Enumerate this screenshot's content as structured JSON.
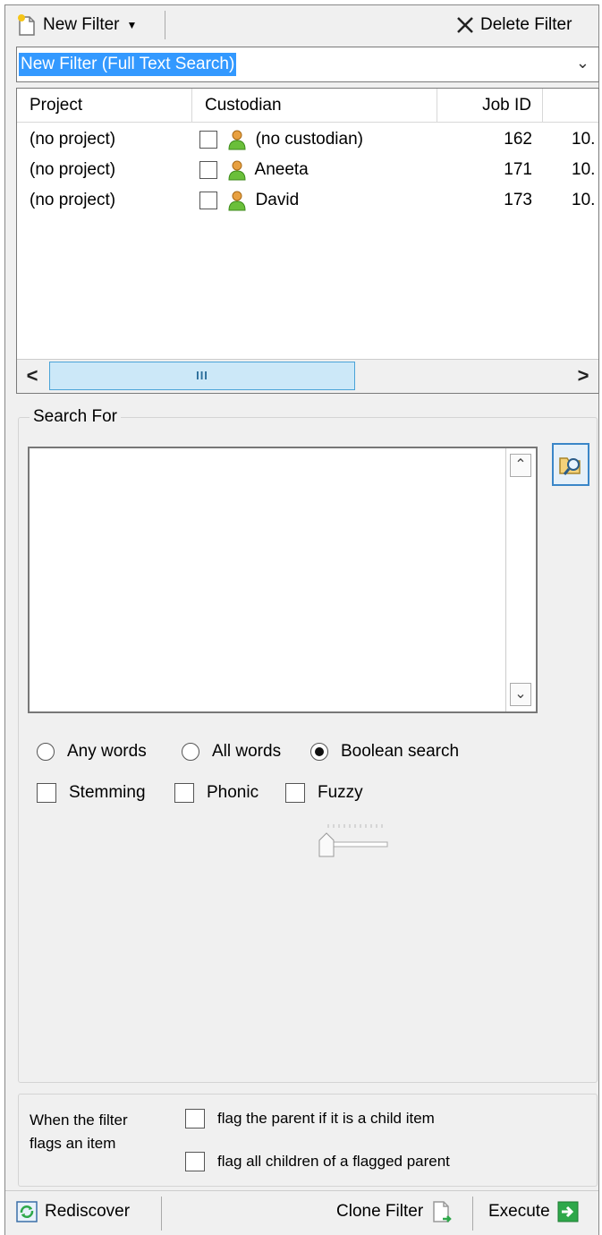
{
  "toolbar": {
    "new_filter_label": "New Filter",
    "delete_filter_label": "Delete Filter"
  },
  "filter_select": {
    "value": "New Filter (Full Text Search)"
  },
  "grid": {
    "columns": [
      "Project",
      "Custodian",
      "Job ID"
    ],
    "rows": [
      {
        "project": "(no project)",
        "custodian": "(no custodian)",
        "job_id": "162",
        "extra": "10."
      },
      {
        "project": "(no project)",
        "custodian": "Aneeta",
        "job_id": "171",
        "extra": "10."
      },
      {
        "project": "(no project)",
        "custodian": "David",
        "job_id": "173",
        "extra": "10."
      }
    ],
    "scroll_thumb_glyph": "III"
  },
  "search": {
    "group_title": "Search For",
    "text": "",
    "modes": [
      {
        "label": "Any words",
        "selected": false
      },
      {
        "label": "All words",
        "selected": false
      },
      {
        "label": "Boolean search",
        "selected": true
      }
    ],
    "options": [
      {
        "label": "Stemming",
        "checked": false
      },
      {
        "label": "Phonic",
        "checked": false
      },
      {
        "label": "Fuzzy",
        "checked": false
      }
    ]
  },
  "flagging": {
    "label": "When the filter flags an item",
    "options": [
      {
        "label": "flag the parent if it is a child item",
        "checked": false
      },
      {
        "label": "flag all children of a flagged parent",
        "checked": false
      }
    ]
  },
  "bottom_bar": {
    "rediscover_label": "Rediscover",
    "clone_filter_label": "Clone Filter",
    "execute_label": "Execute"
  },
  "colors": {
    "selection": "#3399ff",
    "panel_bg": "#f0f0f0",
    "scroll_thumb": "#cce8f8",
    "execute_green": "#2ea84a"
  }
}
